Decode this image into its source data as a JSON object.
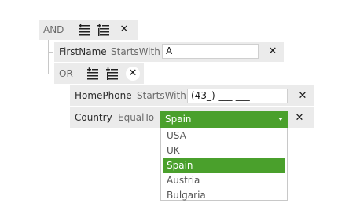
{
  "root": {
    "operator": "AND"
  },
  "conditions": [
    {
      "field": "FirstName",
      "operator": "StartsWith",
      "value": "A"
    }
  ],
  "or_group": {
    "operator": "OR",
    "conditions": [
      {
        "field": "HomePhone",
        "operator": "StartsWith",
        "value": "(43_) ___-___"
      },
      {
        "field": "Country",
        "operator": "EqualTo",
        "value": "Spain"
      }
    ]
  },
  "dropdown": {
    "options": [
      "USA",
      "UK",
      "Spain",
      "Austria",
      "Bulgaria"
    ],
    "selected": "Spain"
  },
  "icons": {
    "add_condition": "add-condition-icon",
    "add_group": "add-group-icon",
    "remove": "close-icon"
  },
  "colors": {
    "accent": "#4aa02c",
    "row_bg": "#ebebeb"
  }
}
